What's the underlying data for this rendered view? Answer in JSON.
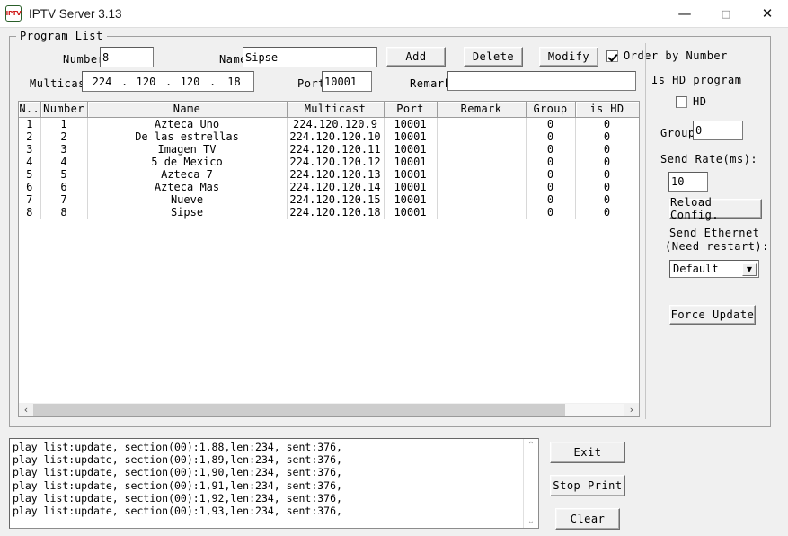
{
  "window": {
    "title": "IPTV Server 3.13",
    "icon": "iptv-logo",
    "icon_text": "IPTV",
    "minimize": "—",
    "maximize": "□",
    "close": "✕"
  },
  "group": {
    "title": "Program List"
  },
  "form": {
    "number_label": "Number",
    "number_value": "8",
    "name_label": "Name",
    "name_value": "Sipse",
    "multicast_label": "Multicast",
    "multicast_octets": [
      "224",
      "120",
      "120",
      "18"
    ],
    "multicast_dot": ".",
    "port_label": "Port",
    "port_value": "10001",
    "remark_label": "Remark",
    "remark_value": "",
    "add_label": "Add",
    "delete_label": "Delete",
    "modify_label": "Modify",
    "order_by_number_label": "Order by Number",
    "order_by_number_checked": true
  },
  "side": {
    "is_hd_program_label": "Is HD program",
    "hd_checkbox_label": "HD",
    "hd_checked": false,
    "group_label": "Group",
    "group_value": "0",
    "send_rate_label": "Send Rate(ms):",
    "send_rate_value": "10",
    "reload_config_label": "Reload Config.",
    "send_ethernet_label_line1": "Send Ethernet",
    "send_ethernet_label_line2": "(Need restart):",
    "ethernet_selected": "Default",
    "ethernet_options": [
      "Default"
    ],
    "force_update_label": "Force Update"
  },
  "table": {
    "columns": [
      "N..",
      "Number",
      "Name",
      "Multicast",
      "Port",
      "Remark",
      "Group",
      "is HD"
    ],
    "rows": [
      {
        "n": "1",
        "number": "1",
        "name": "Azteca Uno",
        "multicast": "224.120.120.9",
        "port": "10001",
        "remark": "",
        "group": "0",
        "is_hd": "0"
      },
      {
        "n": "2",
        "number": "2",
        "name": "De las estrellas",
        "multicast": "224.120.120.10",
        "port": "10001",
        "remark": "",
        "group": "0",
        "is_hd": "0"
      },
      {
        "n": "3",
        "number": "3",
        "name": "Imagen TV",
        "multicast": "224.120.120.11",
        "port": "10001",
        "remark": "",
        "group": "0",
        "is_hd": "0"
      },
      {
        "n": "4",
        "number": "4",
        "name": "5 de Mexico",
        "multicast": "224.120.120.12",
        "port": "10001",
        "remark": "",
        "group": "0",
        "is_hd": "0"
      },
      {
        "n": "5",
        "number": "5",
        "name": "Azteca 7",
        "multicast": "224.120.120.13",
        "port": "10001",
        "remark": "",
        "group": "0",
        "is_hd": "0"
      },
      {
        "n": "6",
        "number": "6",
        "name": "Azteca Mas",
        "multicast": "224.120.120.14",
        "port": "10001",
        "remark": "",
        "group": "0",
        "is_hd": "0"
      },
      {
        "n": "7",
        "number": "7",
        "name": "Nueve",
        "multicast": "224.120.120.15",
        "port": "10001",
        "remark": "",
        "group": "0",
        "is_hd": "0"
      },
      {
        "n": "8",
        "number": "8",
        "name": "Sipse",
        "multicast": "224.120.120.18",
        "port": "10001",
        "remark": "",
        "group": "0",
        "is_hd": "0"
      }
    ],
    "hscroll_left_arrow": "‹",
    "hscroll_right_arrow": "›"
  },
  "log": {
    "text": "play list:update, section(00):1,88,len:234, sent:376,\nplay list:update, section(00):1,89,len:234, sent:376,\nplay list:update, section(00):1,90,len:234, sent:376,\nplay list:update, section(00):1,91,len:234, sent:376,\nplay list:update, section(00):1,92,len:234, sent:376,\nplay list:update, section(00):1,93,len:234, sent:376,",
    "scroll_up_arrow": "⌃",
    "scroll_down_arrow": "⌄"
  },
  "bottom_buttons": {
    "exit_label": "Exit",
    "stop_print_label": "Stop Print",
    "clear_label": "Clear"
  },
  "colors": {
    "window_bg": "#f0f0f0",
    "titlebar_bg": "#ffffff",
    "field_bg": "#ffffff",
    "border": "#a0a0a0",
    "logo_red": "#d01b1b"
  }
}
